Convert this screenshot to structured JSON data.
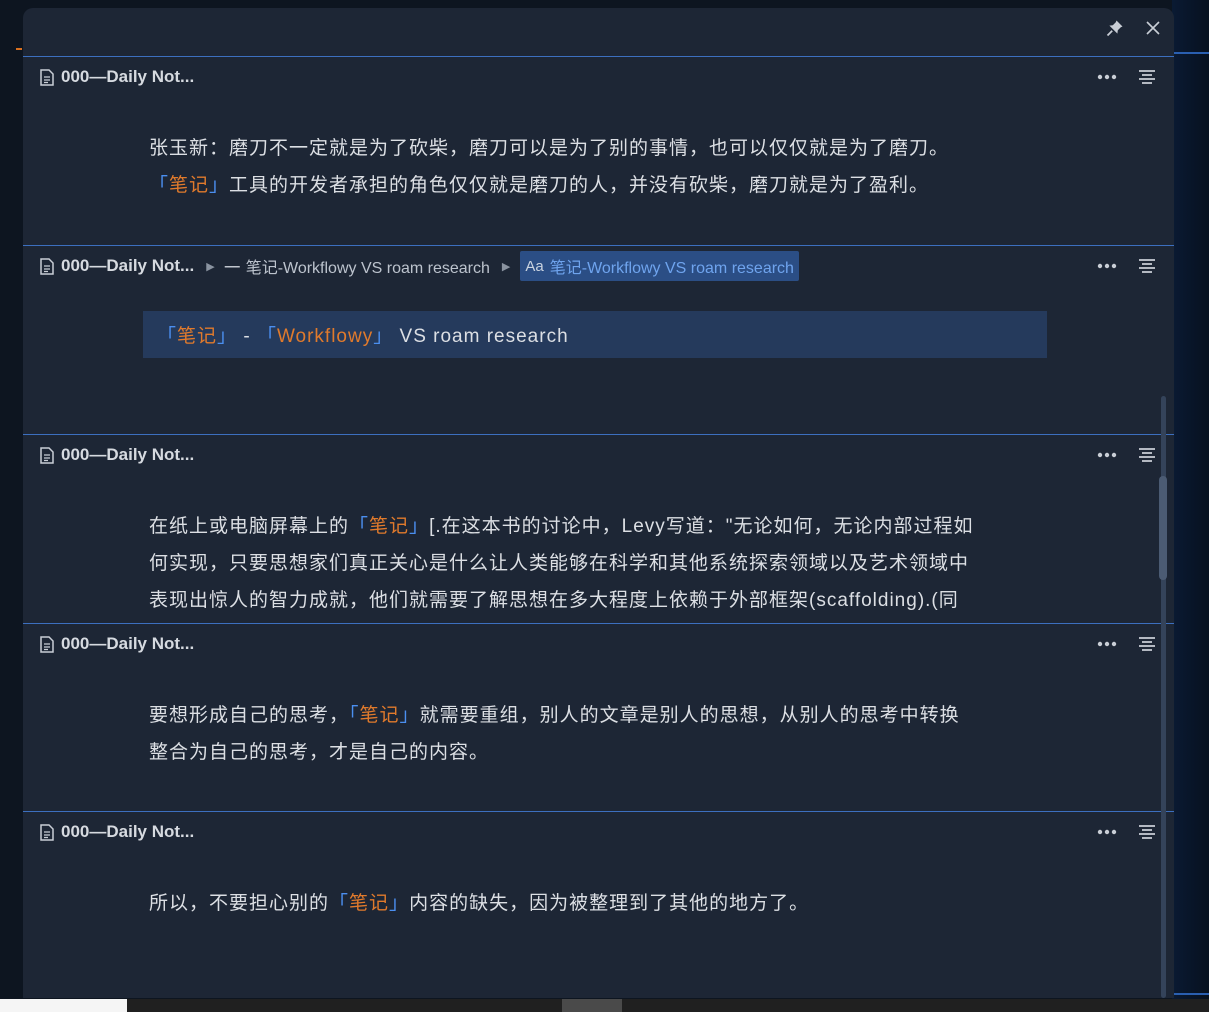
{
  "window": {
    "pin_icon": "pin-icon",
    "close_icon": "close-icon"
  },
  "blocks": [
    {
      "title": "000—Daily Not...",
      "lines": [
        {
          "parts": [
            {
              "t": "张玉新：磨刀不一定就是为了砍柴，磨刀可以是为了别的事情，也可以仅仅就是为了磨刀。"
            }
          ]
        },
        {
          "parts": [
            {
              "t": "「",
              "k": "brk"
            },
            {
              "t": "笔记",
              "k": "ref"
            },
            {
              "t": "」",
              "k": "brk"
            },
            {
              "t": "工具的开发者承担的角色仅仅就是磨刀的人，并没有砍柴，磨刀就是为了盈利。"
            }
          ]
        }
      ]
    },
    {
      "title": "000—Daily Not...",
      "breadcrumb": {
        "item1": "笔记-Workflowy VS roam research",
        "active_prefix": "Aa",
        "active": "笔记-Workflowy VS roam research"
      },
      "quote": [
        {
          "t": "「",
          "k": "brk"
        },
        {
          "t": "笔记",
          "k": "ref"
        },
        {
          "t": "」",
          "k": "brk"
        },
        {
          "t": " - "
        },
        {
          "t": "「",
          "k": "brk"
        },
        {
          "t": "Workflowy",
          "k": "ref"
        },
        {
          "t": "」",
          "k": "brk"
        },
        {
          "t": " VS roam research"
        }
      ]
    },
    {
      "title": "000—Daily Not...",
      "lines": [
        {
          "parts": [
            {
              "t": "在纸上或电脑屏幕上的"
            },
            {
              "t": "「",
              "k": "brk"
            },
            {
              "t": "笔记",
              "k": "ref"
            },
            {
              "t": "」",
              "k": "brk"
            },
            {
              "t": "[.在这本书的讨论中，Levy写道：\"无论如何，无论内部过程如"
            }
          ]
        },
        {
          "parts": [
            {
              "t": "何实现，只要思想家们真正关心是什么让人类能够在科学和其他系统探索领域以及艺术领域中"
            }
          ]
        },
        {
          "parts": [
            {
              "t": "表现出惊人的智力成就，他们就需要了解思想在多大程度上依赖于外部框架(scaffolding).(同"
            }
          ]
        }
      ]
    },
    {
      "title": "000—Daily Not...",
      "lines": [
        {
          "parts": [
            {
              "t": "要想形成自己的思考，"
            },
            {
              "t": "「",
              "k": "brk"
            },
            {
              "t": "笔记",
              "k": "ref"
            },
            {
              "t": "」",
              "k": "brk"
            },
            {
              "t": "就需要重组，别人的文章是别人的思想，从别人的思考中转换"
            }
          ]
        },
        {
          "parts": [
            {
              "t": "整合为自己的思考，才是自己的内容。"
            }
          ]
        }
      ]
    },
    {
      "title": "000—Daily Not...",
      "lines": [
        {
          "parts": [
            {
              "t": "所以，不要担心别的"
            },
            {
              "t": "「",
              "k": "brk"
            },
            {
              "t": "笔记",
              "k": "ref"
            },
            {
              "t": "」",
              "k": "brk"
            },
            {
              "t": "内容的缺失，因为被整理到了其他的地方了。"
            }
          ]
        }
      ]
    }
  ],
  "icons": {
    "doc": "document-icon",
    "more": "more-horizontal-icon",
    "menu": "align-center-icon",
    "crumb_arrow": "triangle-right-icon"
  },
  "colors": {
    "background": "#1d2635",
    "divider": "#3c6fbf",
    "reference": "#e07a2c",
    "bracket": "#4b8ff0",
    "highlight": "#253a5c"
  }
}
